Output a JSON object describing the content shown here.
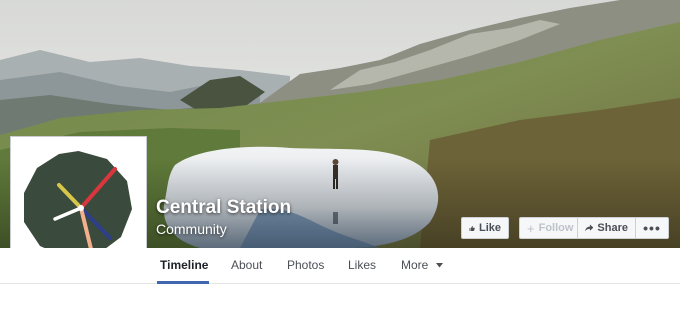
{
  "page": {
    "name": "Central Station",
    "category": "Community"
  },
  "actions": {
    "like_label": "Like",
    "follow_label": "Follow",
    "share_label": "Share",
    "more_label": "•••"
  },
  "tabs": [
    {
      "label": "Timeline",
      "active": true
    },
    {
      "label": "About",
      "active": false
    },
    {
      "label": "Photos",
      "active": false
    },
    {
      "label": "Likes",
      "active": false
    },
    {
      "label": "More",
      "active": false
    }
  ],
  "profile_picture": {
    "description_icon": "clock-logo-icon",
    "background": "#3a4a3c",
    "hand_colors": [
      "#d9363e",
      "#d6c64a",
      "#2f3e8a",
      "#f2b08c",
      "#ffffff"
    ]
  },
  "cover_photo": {
    "icon": "mountain-lake-photo"
  },
  "colors": {
    "accent": "#4267b2",
    "button_bg": "#f6f7f9",
    "button_border": "#ced0d4",
    "text": "#4b4f56"
  }
}
